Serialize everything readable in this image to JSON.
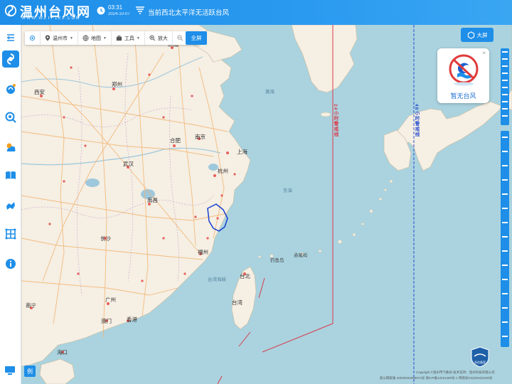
{
  "header": {
    "title": "温州台风网",
    "subtitle": "WWW.WZTF121.COM",
    "time": "03:31",
    "date": "2024-10-07",
    "status": "当前西北太平洋无活跃台风"
  },
  "toolbar": {
    "region": "温州市",
    "basemap": "地图",
    "tools": "工具",
    "zoom_in": "放大",
    "zoom_out": "缩小",
    "fullscreen": "全屏"
  },
  "big_screen": "大屏",
  "no_typhoon": {
    "text": "暂无台风",
    "close": "×"
  },
  "warning_lines": {
    "line24": "24小时警戒线",
    "line48": "48小时警戒线",
    "line24_color": "#d93a4a",
    "line48_color": "#2a4fcf"
  },
  "map_labels": {
    "cities": [
      {
        "name": "济南"
      },
      {
        "name": "郑州"
      },
      {
        "name": "西安"
      },
      {
        "name": "合肥"
      },
      {
        "name": "南京"
      },
      {
        "name": "上海"
      },
      {
        "name": "武汉"
      },
      {
        "name": "杭州"
      },
      {
        "name": "南昌"
      },
      {
        "name": "长沙"
      },
      {
        "name": "福州"
      },
      {
        "name": "台北"
      },
      {
        "name": "广州"
      },
      {
        "name": "南宁"
      },
      {
        "name": "澳门"
      },
      {
        "name": "香港"
      },
      {
        "name": "海口"
      },
      {
        "name": "台湾"
      }
    ],
    "seas": [
      "黄海",
      "东海",
      "台湾海峡"
    ],
    "islands": [
      "钓鱼岛",
      "赤尾屿"
    ]
  },
  "legend_btn": "例",
  "footer": {
    "copyright": "Copyright ©温州市气象局 技术支持：温州科技有限公司",
    "beian": "浙公网安备 33030202000073号   浙ICP备12021459号-1   审图号GS(2024)2236号"
  },
  "badge": "浙信备案",
  "colors": {
    "header_blue": "#1e8ee8",
    "sea": "#aad3df",
    "land": "#f5efe4",
    "road": "#f4b26b"
  },
  "icons": {
    "menu": "menu-icon",
    "typhoon": "typhoon-icon",
    "satellite": "satellite-icon",
    "radar": "radar-icon",
    "weather": "weather-icon",
    "book": "book-icon",
    "ship": "ship-icon",
    "grid": "grid-icon",
    "info": "info-icon",
    "monitor": "monitor-icon"
  }
}
